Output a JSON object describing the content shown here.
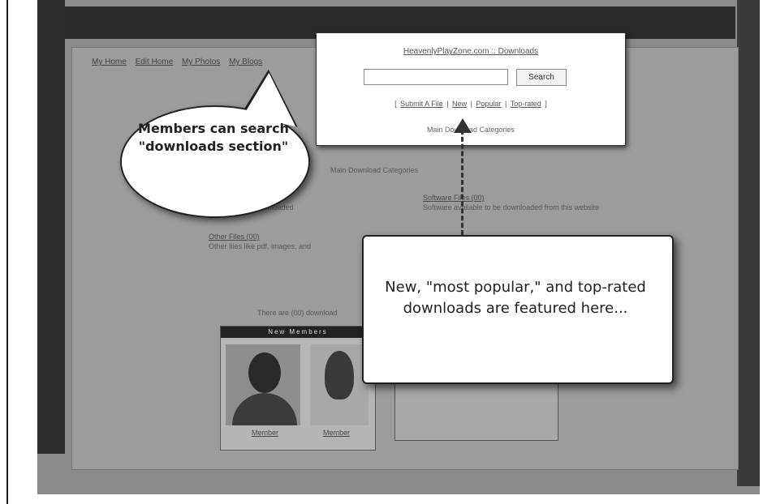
{
  "site_nav": {
    "items": [
      "My Home",
      "Edit Home",
      "My Photos",
      "My Blogs"
    ]
  },
  "background_text": {
    "categories_heading": "Main Download Categories",
    "software_link": "Software Files (00)",
    "software_desc": "Software available to be downloaded from this website",
    "other_link": "Other Files (00)",
    "other_desc": "Other files like pdf, images, and",
    "downloaded_left": "downloaded",
    "there_are": "There are (00) download",
    "members_header": "New Members",
    "member1": "Member",
    "member2": "Member"
  },
  "popup": {
    "title": "HeavenlyPlayZone.com :: Downloads",
    "search_placeholder": "",
    "search_button": "Search",
    "links": {
      "submit": "Submit A File",
      "new": "New",
      "popular": "Popular",
      "top_rated": "Top-rated"
    },
    "categories": "Main Download Categories"
  },
  "bubble": {
    "text": "Members can search \"downloads section\""
  },
  "callout": {
    "text": "New, \"most popular,\" and top-rated downloads are featured here..."
  }
}
